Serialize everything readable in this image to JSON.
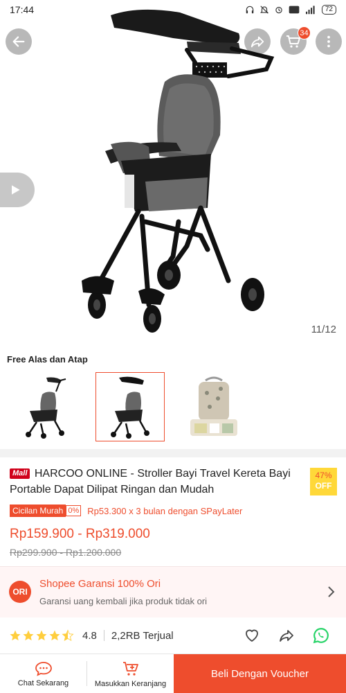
{
  "status_bar": {
    "time": "17:44",
    "battery": "72"
  },
  "gallery": {
    "counter": "11/12",
    "cart_count": "34"
  },
  "variation": {
    "title": "Free Alas dan Atap"
  },
  "product": {
    "mall_label": "Mall",
    "title": "HARCOO ONLINE - Stroller Bayi Travel Kereta Bayi Portable Dapat Dilipat Ringan dan Mudah",
    "discount_percent": "47%",
    "discount_off": "OFF",
    "installment_label": "Cicilan Murah",
    "installment_rate": "0%",
    "installment_text": "Rp53.300 x 3 bulan dengan SPayLater",
    "price": "Rp159.900 - Rp319.000",
    "old_price": "Rp299.900 - Rp1.200.000"
  },
  "guarantee": {
    "badge": "ORI",
    "title": "Shopee Garansi 100% Ori",
    "description": "Garansi uang kembali jika produk tidak ori"
  },
  "rating": {
    "value": "4.8",
    "stars": 4.5,
    "sold": "2,2RB Terjual"
  },
  "bottom_bar": {
    "chat_label": "Chat Sekarang",
    "cart_label": "Masukkan Keranjang",
    "buy_label": "Beli Dengan Voucher"
  },
  "colors": {
    "accent": "#ee4d2d",
    "star": "#ffce3d",
    "whatsapp": "#25d366"
  }
}
